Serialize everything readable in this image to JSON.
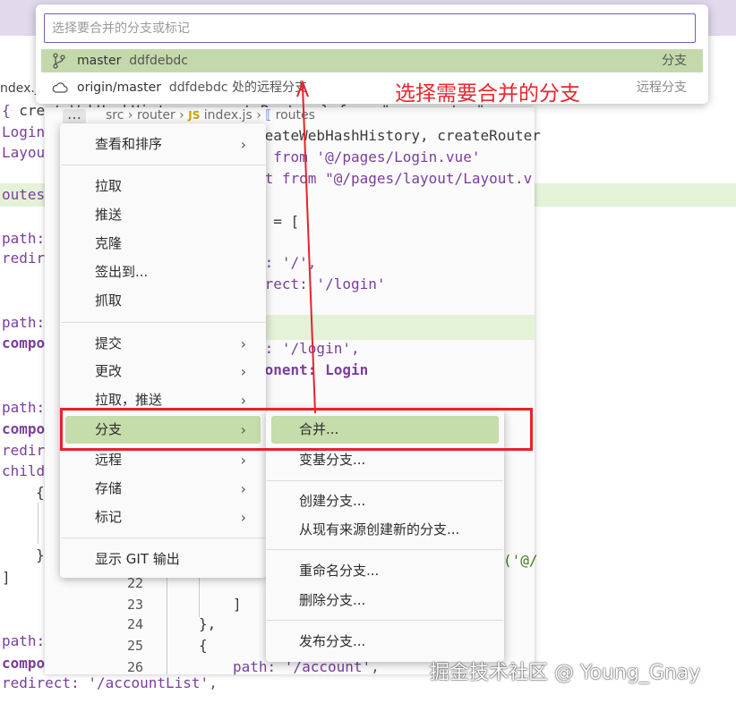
{
  "quick_pick": {
    "placeholder": "选择要合并的分支或标记",
    "items": [
      {
        "icon": "branch-icon",
        "name": "master",
        "commit": "ddfdebdc",
        "tag": "分支"
      },
      {
        "icon": "cloud-icon",
        "name": "origin/master",
        "commit": "ddfdebdc",
        "desc": "处的远程分支",
        "tag": "远程分支"
      }
    ]
  },
  "annotation": "选择需要合并的分支",
  "watermark": "掘金技术社区 @ Young_Gnay",
  "background_editor": {
    "tab_fragment": "ndex.js",
    "lines": [
      {
        "t1": "{ ",
        "t2": "createWebHashHistory",
        "t3": ", createRouter } from \"vue-router\";"
      },
      {
        "t1": "Login"
      },
      {
        "t1": "Layout"
      },
      {
        "t1": "outes ="
      },
      {
        "t1": "path:"
      },
      {
        "t1": "redire"
      },
      {
        "t1": "path:"
      },
      {
        "t1": "compo"
      },
      {
        "t1": "path:"
      },
      {
        "t1": "compo"
      },
      {
        "t1": "redire"
      },
      {
        "t1": "child"
      },
      {
        "t1": "{"
      },
      {
        "t1": "}"
      },
      {
        "t1": "]"
      },
      {
        "t1": "path:"
      },
      {
        "t1": "compo"
      },
      {
        "t1": "redirect: '/accountList',"
      }
    ]
  },
  "panel": {
    "breadcrumb": {
      "more": "…",
      "src": "src",
      "router": "router",
      "js_badge": "JS",
      "file": "index.js",
      "symbol": "routes"
    },
    "code": [
      "reateWebHashHistory, createRouter",
      "n from '@/pages/Login.vue'",
      "ut from \"@/pages/layout/Layout.v",
      "s = [",
      "h: '/',",
      "irect: '/login'",
      "h: '/login',",
      "ponent: Login",
      "('@/",
      "]",
      "},",
      "{",
      "path: '/account',"
    ],
    "line_numbers": [
      "22",
      "23",
      "24",
      "25",
      "26"
    ]
  },
  "context_menu": {
    "items": [
      {
        "label": "查看和排序",
        "submenu": true
      },
      {
        "label": "拉取"
      },
      {
        "label": "推送"
      },
      {
        "label": "克隆"
      },
      {
        "label": "签出到..."
      },
      {
        "label": "抓取"
      },
      {
        "label": "提交",
        "submenu": true
      },
      {
        "label": "更改",
        "submenu": true
      },
      {
        "label": "拉取，推送",
        "submenu": true
      },
      {
        "label": "分支",
        "submenu": true
      },
      {
        "label": "远程",
        "submenu": true
      },
      {
        "label": "存储",
        "submenu": true
      },
      {
        "label": "标记",
        "submenu": true
      },
      {
        "label": "显示 GIT 输出"
      }
    ],
    "arrow_glyph": "›"
  },
  "branch_submenu": {
    "items": [
      {
        "label": "合并..."
      },
      {
        "label": "变基分支..."
      },
      {
        "label": "创建分支..."
      },
      {
        "label": "从现有来源创建新的分支..."
      },
      {
        "label": "重命名分支..."
      },
      {
        "label": "删除分支..."
      },
      {
        "label": "发布分支..."
      }
    ]
  },
  "colors": {
    "highlight": "#c5dcab",
    "annotation_red": "#e6232a",
    "input_border": "#7a5ab8"
  }
}
